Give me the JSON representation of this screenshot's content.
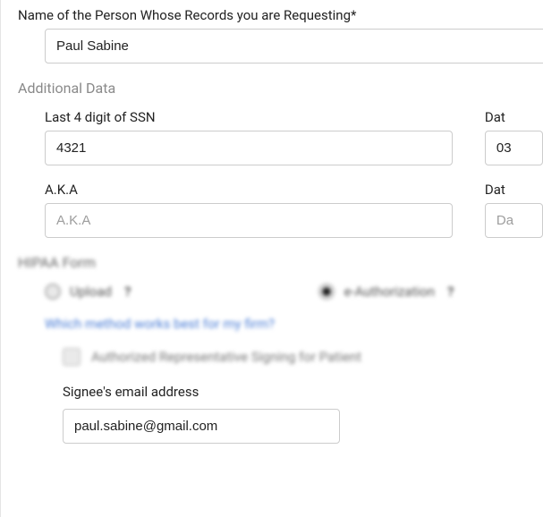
{
  "name_field": {
    "label": "Name of the Person Whose Records you are Requesting*",
    "value": "Paul Sabine"
  },
  "additional_data_heading": "Additional Data",
  "ssn": {
    "label": "Last 4 digit of SSN",
    "value": "4321"
  },
  "date1": {
    "label": "Dat",
    "value": "03"
  },
  "aka": {
    "label": "A.K.A",
    "placeholder": "A.K.A",
    "value": ""
  },
  "date2": {
    "label": "Dat",
    "placeholder": "Da",
    "value": ""
  },
  "hipaa_heading": "HIPAA Form",
  "radio": {
    "upload": "Upload",
    "eauth": "e-Authorization",
    "selected": "eauth"
  },
  "method_link": "Which method works best for my firm?",
  "auth_rep_checkbox_label": "Authorized Representative Signing for Patient",
  "signee": {
    "label": "Signee's email address",
    "value": "paul.sabine@gmail.com"
  }
}
